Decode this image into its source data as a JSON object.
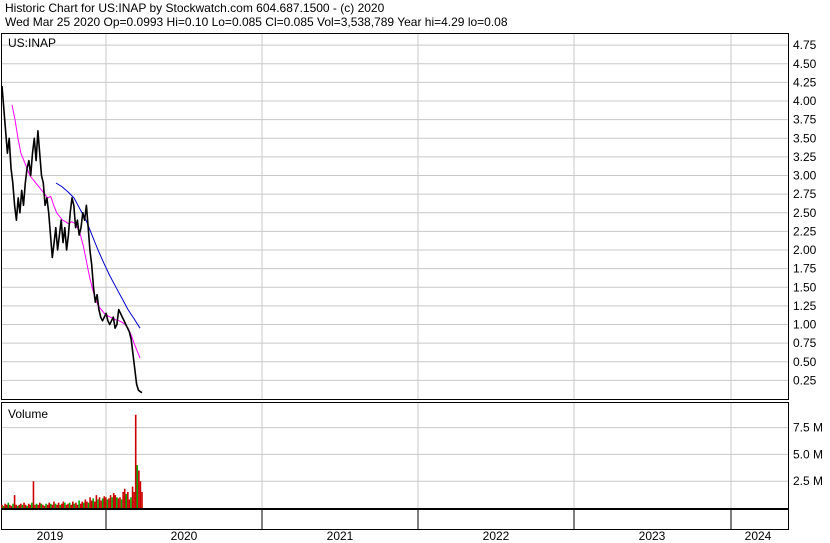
{
  "header": {
    "line1": "Historic Chart for US:INAP by Stockwatch.com 604.687.1500 - (c) 2020",
    "line2": "Wed Mar 25 2020   Op=0.0993  Hi=0.10  Lo=0.085  Cl=0.085  Vol=3,538,789  Year hi=4.29  lo=0.08"
  },
  "colors": {
    "price": "#000000",
    "ma_short": "#ff00ff",
    "ma_long": "#0000cc",
    "volume_up": "#00aa00",
    "volume_down": "#cc0000",
    "grid": "#c8c8c8"
  },
  "chart_data": [
    {
      "type": "line",
      "title": "US:INAP",
      "ylim": [
        0,
        4.9
      ],
      "y_ticks": [
        "4.75",
        "4.50",
        "4.25",
        "4.00",
        "3.75",
        "3.50",
        "3.25",
        "3.00",
        "2.75",
        "2.50",
        "2.25",
        "2.00",
        "1.75",
        "1.50",
        "1.25",
        "1.00",
        "0.75",
        "0.50",
        "0.25"
      ],
      "x_ticks": [
        "2019",
        "2020",
        "2021",
        "2022",
        "2023",
        "2024"
      ],
      "grid": true,
      "series": [
        {
          "values": [
            4.2,
            3.9,
            3.6,
            3.3,
            3.5,
            3.1,
            2.9,
            2.6,
            2.4,
            2.7,
            2.5,
            2.8,
            2.6,
            2.9,
            3.1,
            3.2,
            3.0,
            3.3,
            3.5,
            3.2,
            3.6,
            3.3,
            3.0,
            2.9,
            2.6,
            2.7,
            2.5,
            2.2,
            1.9,
            2.1,
            2.3,
            2.0,
            2.2,
            2.4,
            2.1,
            2.3,
            2.0,
            2.2,
            2.5,
            2.7,
            2.6,
            2.3,
            2.4,
            2.2,
            2.3,
            2.5,
            2.4,
            2.6,
            2.3,
            2.0,
            1.8,
            1.5,
            1.3,
            1.4,
            1.2,
            1.1,
            1.05,
            1.1,
            1.15,
            1.05,
            1.0,
            1.05,
            1.1,
            0.95,
            1.0,
            1.2,
            1.15,
            1.1,
            1.05,
            1.0,
            0.95,
            0.9,
            0.8,
            0.6,
            0.4,
            0.2,
            0.12,
            0.1,
            0.085
          ]
        },
        {
          "values": [
            3.95,
            3.75,
            3.5,
            3.3,
            3.2,
            3.1,
            3.0,
            2.95,
            2.9,
            2.85,
            2.8,
            2.75,
            2.7,
            2.72,
            2.6,
            2.5,
            2.45,
            2.4,
            2.38,
            2.35,
            2.38,
            2.36,
            2.3,
            2.2,
            2.05,
            1.85,
            1.65,
            1.48,
            1.35,
            1.25,
            1.2,
            1.15,
            1.12,
            1.1,
            1.08,
            1.06,
            1.05,
            1.03,
            1.0,
            0.95,
            0.86,
            0.75,
            0.65,
            0.55
          ]
        },
        {
          "values": [
            2.9,
            2.85,
            2.78,
            2.7,
            2.55,
            2.4,
            2.2,
            2.0,
            1.82,
            1.65,
            1.5,
            1.35,
            1.2,
            1.08,
            0.95
          ]
        }
      ]
    },
    {
      "type": "bar",
      "title": "Volume",
      "ylim": [
        0,
        9.8
      ],
      "y_ticks": [
        "7.5 M",
        "5.0 M",
        "2.5 M"
      ],
      "grid": true,
      "values": [
        0.3,
        0.2,
        0.4,
        0.3,
        0.5,
        0.3,
        0.2,
        0.4,
        1.2,
        0.3,
        0.2,
        0.3,
        0.4,
        0.3,
        0.5,
        0.3,
        0.2,
        0.4,
        0.3,
        0.5,
        2.5,
        0.3,
        0.4,
        0.3,
        0.5,
        0.4,
        0.3,
        0.2,
        0.4,
        0.3,
        0.5,
        0.4,
        0.3,
        0.6,
        0.4,
        0.3,
        0.5,
        0.3,
        0.4,
        0.6,
        0.5,
        0.3,
        0.4,
        0.5,
        0.3,
        0.6,
        0.4,
        0.5,
        0.3,
        0.7,
        0.4,
        0.6,
        0.5,
        0.8,
        0.6,
        0.5,
        1.0,
        0.7,
        0.9,
        0.6,
        1.2,
        0.8,
        1.0,
        0.7,
        0.9,
        1.1,
        1.0,
        0.8,
        0.9,
        1.2,
        1.0,
        1.4,
        1.2,
        1.0,
        0.9,
        1.0,
        0.8,
        1.5,
        1.8,
        1.3,
        1.5,
        0.8,
        1.0,
        2.0,
        1.5,
        8.7,
        4.0,
        3.5,
        2.5,
        1.5
      ],
      "up": [
        false,
        true,
        false,
        false,
        true,
        false,
        false,
        true,
        false,
        false,
        true,
        false,
        false,
        true,
        false,
        false,
        true,
        false,
        false,
        true,
        false,
        false,
        true,
        false,
        false,
        true,
        false,
        false,
        true,
        false,
        false,
        true,
        false,
        false,
        true,
        false,
        false,
        true,
        false,
        false,
        true,
        false,
        false,
        true,
        false,
        false,
        true,
        false,
        false,
        true,
        false,
        false,
        true,
        false,
        false,
        true,
        false,
        false,
        true,
        false,
        false,
        true,
        false,
        false,
        true,
        false,
        false,
        true,
        false,
        false,
        true,
        false,
        false,
        true,
        false,
        false,
        true,
        false,
        false,
        true,
        false,
        false,
        true,
        false,
        false,
        false,
        true,
        false,
        false,
        false
      ]
    }
  ]
}
